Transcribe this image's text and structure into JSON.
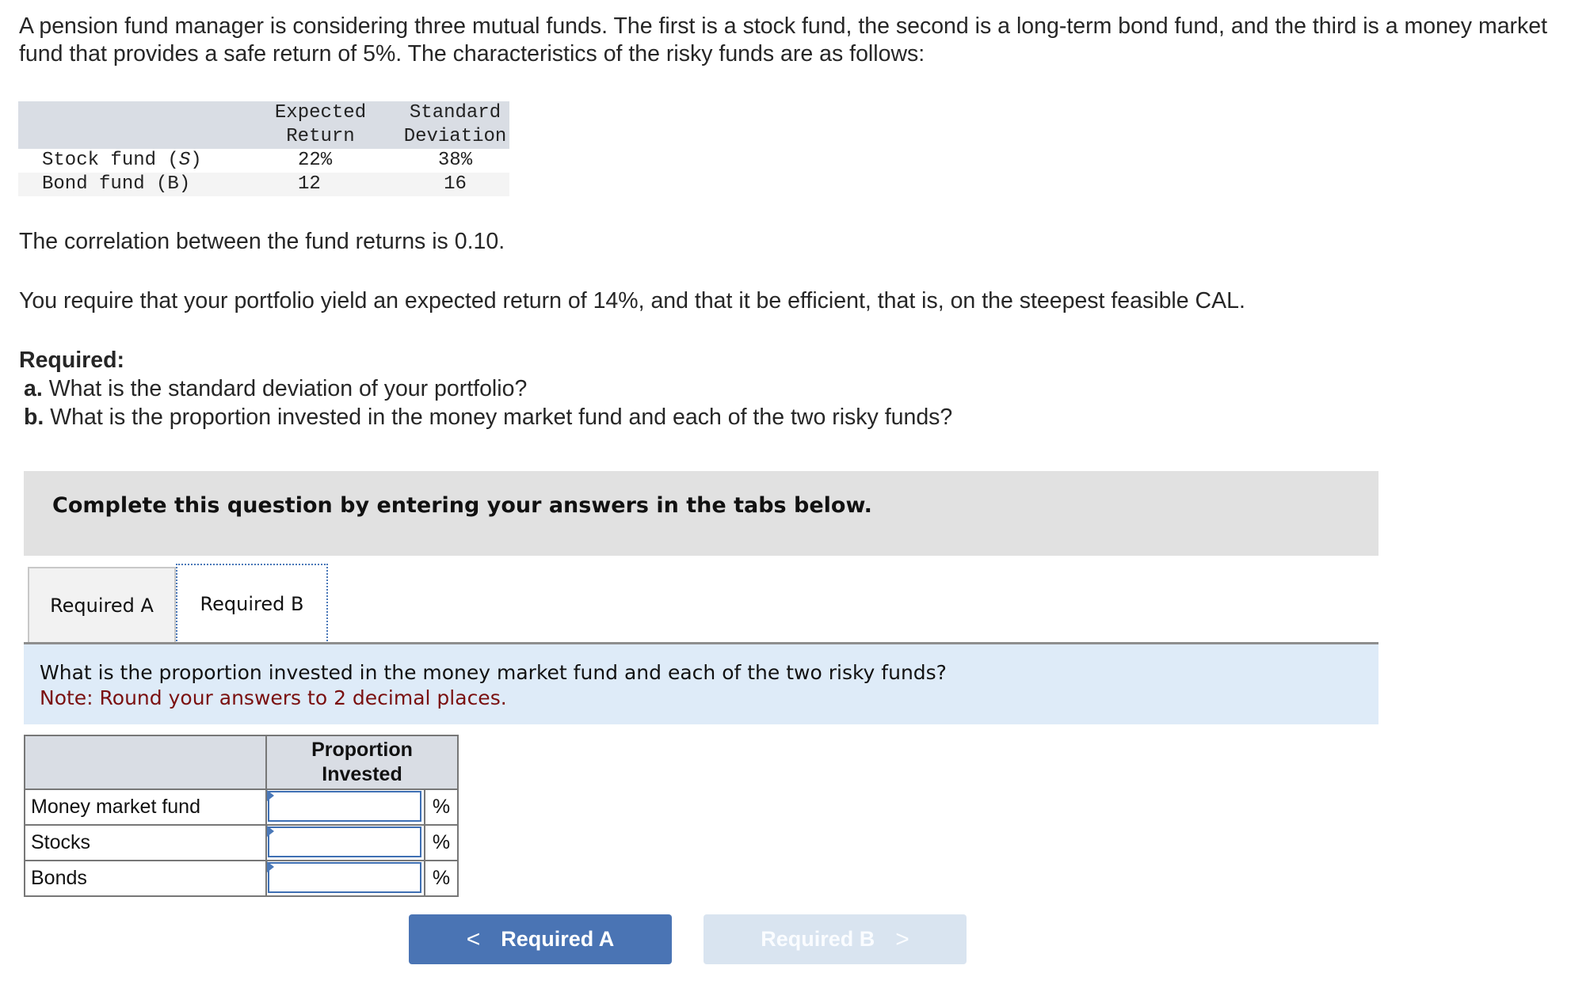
{
  "problem": {
    "intro": "A pension fund manager is considering three mutual funds. The first is a stock fund, the second is a long-term bond fund, and the third is a money market fund that provides a safe return of 5%. The characteristics of the risky funds are as follows:",
    "fund_table": {
      "headers": [
        "",
        "Expected Return",
        "Standard Deviation"
      ],
      "header_lines": [
        [
          "Expected",
          "Return"
        ],
        [
          "Standard",
          "Deviation"
        ]
      ],
      "rows": [
        {
          "label": "Stock fund (",
          "label_italic": "S",
          "label_end": ")",
          "expected_return": "22%",
          "std_dev": "38%"
        },
        {
          "label": "Bond fund (B)",
          "expected_return": "12",
          "std_dev": "16"
        }
      ]
    },
    "correlation": "The correlation between the fund returns is 0.10.",
    "requirement": "You require that your portfolio yield an expected return of 14%, and that it be efficient, that is, on the steepest feasible CAL.",
    "required_heading": "Required:",
    "required_a_prefix": "a.",
    "required_a": " What is the standard deviation of your portfolio?",
    "required_b_prefix": "b.",
    "required_b": " What is the proportion invested in the money market fund and each of the two risky funds?"
  },
  "instructions": "Complete this question by entering your answers in the tabs below.",
  "tabs": [
    {
      "label": "Required A",
      "active": false
    },
    {
      "label": "Required B",
      "active": true
    }
  ],
  "question": {
    "text": "What is the proportion invested in the money market fund and each of the two risky funds?",
    "note": "Note: Round your answers to 2 decimal places."
  },
  "answer_table": {
    "header_lines": [
      "Proportion",
      "Invested"
    ],
    "rows": [
      {
        "label": "Money market fund",
        "value": "",
        "unit": "%"
      },
      {
        "label": "Stocks",
        "value": "",
        "unit": "%"
      },
      {
        "label": "Bonds",
        "value": "",
        "unit": "%"
      }
    ]
  },
  "nav": {
    "prev_label": "Required A",
    "prev_icon": "<",
    "next_label": "Required B",
    "next_icon": ">",
    "next_disabled": true
  },
  "colors": {
    "accent": "#4a74b4",
    "note_red": "#7a1010",
    "question_bg": "#deebf8"
  }
}
